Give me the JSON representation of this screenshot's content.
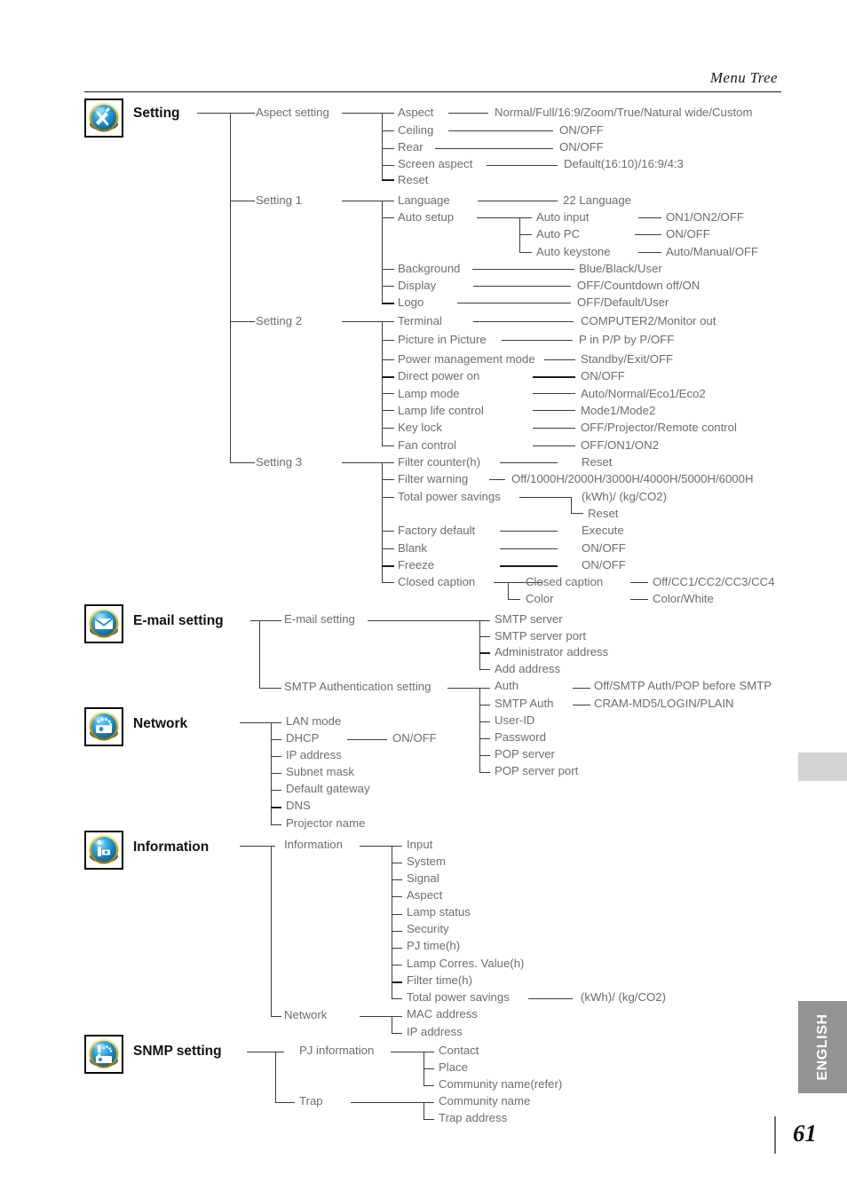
{
  "header": {
    "title": "Menu Tree"
  },
  "footer": {
    "page_number": "61",
    "language_tab": "ENGLISH"
  },
  "colors": {
    "icon_ring": "#e8c52a",
    "icon_body": "#1e8fd5",
    "tab_gray": "#939393",
    "tab_gray_light": "#d2d2d2",
    "line": "#3c3c3c",
    "text": "#6d6d6d"
  },
  "sections": [
    {
      "id": "setting",
      "title": "Setting",
      "icon": "tools-icon",
      "level1": [
        {
          "label": "Aspect setting"
        },
        {
          "label": "Setting 1"
        },
        {
          "label": "Setting 2"
        },
        {
          "label": "Setting 3"
        }
      ],
      "level2": [
        {
          "label": "Aspect",
          "value": "Normal/Full/16:9/Zoom/True/Natural wide/Custom"
        },
        {
          "label": "Ceiling",
          "value": "ON/OFF"
        },
        {
          "label": "Rear",
          "value": "ON/OFF"
        },
        {
          "label": "Screen aspect",
          "value": "Default(16:10)/16:9/4:3"
        },
        {
          "label": "Reset",
          "value": ""
        },
        {
          "label": "Language",
          "value": "22 Language"
        },
        {
          "label": "Auto setup",
          "value": ""
        },
        {
          "label": "Background",
          "value": "Blue/Black/User"
        },
        {
          "label": "Display",
          "value": "OFF/Countdown off/ON"
        },
        {
          "label": "Logo",
          "value": "OFF/Default/User"
        },
        {
          "label": "Terminal",
          "value": "COMPUTER2/Monitor out"
        },
        {
          "label": "Picture in Picture",
          "value": "P in P/P by P/OFF"
        },
        {
          "label": "Power management mode",
          "value": "Standby/Exit/OFF"
        },
        {
          "label": "Direct power on",
          "value": "ON/OFF"
        },
        {
          "label": "Lamp mode",
          "value": "Auto/Normal/Eco1/Eco2"
        },
        {
          "label": "Lamp life control",
          "value": "Mode1/Mode2"
        },
        {
          "label": "Key lock",
          "value": "OFF/Projector/Remote control"
        },
        {
          "label": "Fan control",
          "value": "OFF/ON1/ON2"
        },
        {
          "label": "Filter counter(h)",
          "value": "Reset"
        },
        {
          "label": "Filter warning",
          "value": "Off/1000H/2000H/3000H/4000H/5000H/6000H"
        },
        {
          "label": "Total power savings",
          "value": ""
        },
        {
          "label": "Factory default",
          "value": "Execute"
        },
        {
          "label": "Blank",
          "value": "ON/OFF"
        },
        {
          "label": "Freeze",
          "value": "ON/OFF"
        },
        {
          "label": "Closed caption",
          "value": ""
        }
      ],
      "auto_setup_children": [
        {
          "label": "Auto input",
          "value": "ON1/ON2/OFF"
        },
        {
          "label": "Auto PC",
          "value": "ON/OFF"
        },
        {
          "label": "Auto keystone",
          "value": "Auto/Manual/OFF"
        }
      ],
      "total_power_savings_children": [
        {
          "label": "(kWh)/ (kg/CO2)"
        },
        {
          "label": "Reset"
        }
      ],
      "closed_caption_children": [
        {
          "label": "Closed caption",
          "value": "Off/CC1/CC2/CC3/CC4"
        },
        {
          "label": "Color",
          "value": "Color/White"
        }
      ]
    },
    {
      "id": "email-setting",
      "title": "E-mail setting",
      "icon": "envelope-icon",
      "level1": [
        {
          "label": "E-mail setting"
        },
        {
          "label": "SMTP Authentication setting"
        }
      ],
      "email_children": [
        {
          "label": "SMTP server"
        },
        {
          "label": "SMTP server port"
        },
        {
          "label": "Administrator address"
        },
        {
          "label": "Add address"
        }
      ],
      "smtp_children": [
        {
          "label": "Auth",
          "value": "Off/SMTP Auth/POP before SMTP"
        },
        {
          "label": "SMTP Auth",
          "value": "CRAM-MD5/LOGIN/PLAIN"
        },
        {
          "label": "User-ID",
          "value": ""
        },
        {
          "label": "Password",
          "value": ""
        },
        {
          "label": "POP server",
          "value": ""
        },
        {
          "label": "POP server port",
          "value": ""
        }
      ]
    },
    {
      "id": "network",
      "title": "Network",
      "icon": "network-icon",
      "items": [
        {
          "label": "LAN mode",
          "value": ""
        },
        {
          "label": "DHCP",
          "value": "ON/OFF"
        },
        {
          "label": "IP address",
          "value": ""
        },
        {
          "label": "Subnet mask",
          "value": ""
        },
        {
          "label": "Default gateway",
          "value": ""
        },
        {
          "label": "DNS",
          "value": ""
        },
        {
          "label": "Projector name",
          "value": ""
        }
      ]
    },
    {
      "id": "information",
      "title": "Information",
      "icon": "information-icon",
      "level1": [
        {
          "label": "Information"
        },
        {
          "label": "Network"
        }
      ],
      "information_children": [
        {
          "label": "Input",
          "value": ""
        },
        {
          "label": "System",
          "value": ""
        },
        {
          "label": "Signal",
          "value": ""
        },
        {
          "label": "Aspect",
          "value": ""
        },
        {
          "label": "Lamp status",
          "value": ""
        },
        {
          "label": "Security",
          "value": ""
        },
        {
          "label": "PJ time(h)",
          "value": ""
        },
        {
          "label": "Lamp Corres. Value(h)",
          "value": ""
        },
        {
          "label": "Filter time(h)",
          "value": ""
        },
        {
          "label": "Total power savings",
          "value": "(kWh)/ (kg/CO2)"
        }
      ],
      "network_children": [
        {
          "label": "MAC address"
        },
        {
          "label": "IP address"
        }
      ]
    },
    {
      "id": "snmp-setting",
      "title": "SNMP setting",
      "icon": "snmp-icon",
      "level1": [
        {
          "label": "PJ information"
        },
        {
          "label": "Trap"
        }
      ],
      "pj_information_children": [
        {
          "label": "Contact"
        },
        {
          "label": "Place"
        },
        {
          "label": "Community name(refer)"
        }
      ],
      "trap_children": [
        {
          "label": "Community name"
        },
        {
          "label": "Trap address"
        }
      ]
    }
  ]
}
